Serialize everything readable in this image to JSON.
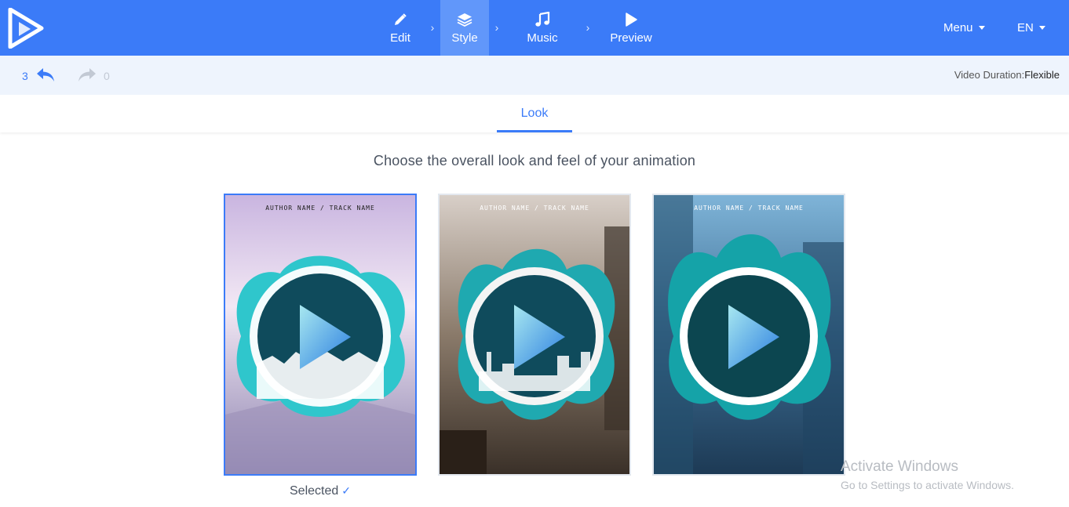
{
  "topbar": {
    "steps": [
      {
        "label": "Edit",
        "icon": "pencil-icon"
      },
      {
        "label": "Style",
        "icon": "layers-icon"
      },
      {
        "label": "Music",
        "icon": "music-note-icon"
      },
      {
        "label": "Preview",
        "icon": "play-icon"
      }
    ],
    "active_step": "Style",
    "menu_label": "Menu",
    "language": "EN",
    "accent_color": "#3b7bf8"
  },
  "history": {
    "undo_count": "3",
    "redo_count": "0"
  },
  "duration": {
    "label": "Video Duration:",
    "value": "Flexible"
  },
  "tabs": [
    {
      "label": "Look"
    }
  ],
  "headline": "Choose the overall look and feel of your animation",
  "looks": [
    {
      "caption": "AUTHOR NAME / TRACK NAME",
      "selected": true
    },
    {
      "caption": "AUTHOR NAME / TRACK NAME",
      "selected": false
    },
    {
      "caption": "AUTHOR NAME / TRACK NAME",
      "selected": false
    }
  ],
  "selected_label": "Selected",
  "watermark": {
    "title": "Activate Windows",
    "subtitle": "Go to Settings to activate Windows."
  }
}
